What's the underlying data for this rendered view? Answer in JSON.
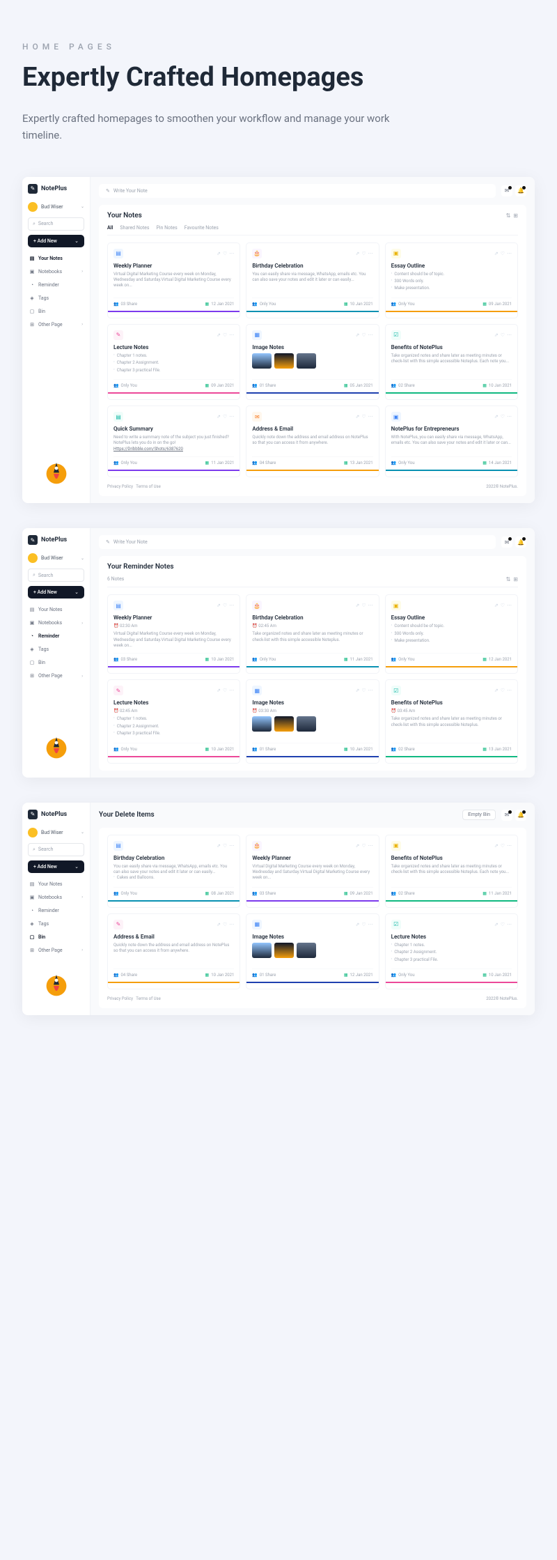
{
  "hero": {
    "eyebrow": "HOME PAGES",
    "headline": "Expertly Crafted Homepages",
    "subhead": "Expertly crafted homepages to smoothen your workflow and manage your work timeline."
  },
  "common": {
    "brand": "NotePlus",
    "user": "Bud Wiser",
    "search": "Search",
    "addnew": "Add New",
    "write": "Write Your Note",
    "nav": {
      "notes": "Your Notes",
      "notebooks": "Notebooks",
      "reminder": "Reminder",
      "tags": "Tags",
      "bin": "Bin",
      "other": "Other Page"
    },
    "footer": {
      "privacy": "Privacy Policy",
      "terms": "Terms of Use",
      "copy": "2022© NotePlus."
    }
  },
  "s1": {
    "title": "Your Notes",
    "tabs": {
      "all": "All",
      "shared": "Shared Notes",
      "pin": "Pin Notes",
      "fav": "Favourite Notes"
    },
    "cards": [
      {
        "title": "Weekly Planner",
        "body": "Virtual Digital Marketing Course every week on Monday, Wednesday and Saturday.Virtual Digital Marketing Course every week on...",
        "share": "03 Share",
        "date": "12 Jan 2021",
        "bar": "#7c3aed"
      },
      {
        "title": "Birthday Celebration",
        "body": "You can easily share via message, WhatsApp, emails etc. You can also save your notes and edit it later or can easily...",
        "share": "Only You",
        "date": "10 Jan 2021",
        "bar": "#0891b2"
      },
      {
        "title": "Essay Outline",
        "items": [
          "Content should be of topic.",
          "300 Words only.",
          "Make presentation."
        ],
        "share": "Only You",
        "date": "09 Jan 2021",
        "bar": "#f59e0b"
      },
      {
        "title": "Lecture Notes",
        "items": [
          "Chapter 1 notes.",
          "Chapter 2 Assignment.",
          "Chapter 3 practical File."
        ],
        "share": "Only You",
        "date": "09 Jan 2021",
        "bar": "#ec4899"
      },
      {
        "title": "Image Notes",
        "thumbs": true,
        "share": "01 Share",
        "date": "05 Jan 2021",
        "bar": "#1e40af"
      },
      {
        "title": "Benefits of NotePlus",
        "body": "Take organized notes and share later as meeting minutes or check-list with this simple accessible Noteplus. Each note you...",
        "share": "02 Share",
        "date": "10 Jan 2021",
        "bar": "#10b981"
      },
      {
        "title": "Quick Summary",
        "body": "Need to write a summary note of the subject you just finished? NotePlus lets you do in on the go!",
        "link": "Https://Dribbble.com/Shots/6387620",
        "share": "Only You",
        "date": "11 Jan 2021",
        "bar": "#7c3aed"
      },
      {
        "title": "Address & Email",
        "body": "Quickly note down the address and email address on NotePlus so that you can access it from anywhere.",
        "share": "04 Share",
        "date": "13 Jan 2021",
        "bar": "#f59e0b"
      },
      {
        "title": "NotePlus for Entrepreneurs",
        "body": "With NotePlus, you can easily share via message, WhatsApp, emails etc. You can also save your notes and edit it later or can...",
        "share": "Only You",
        "date": "14 Jan 2021",
        "bar": "#0891b2"
      }
    ]
  },
  "s2": {
    "title": "Your Reminder Notes",
    "count": "6 Notes",
    "cards": [
      {
        "title": "Weekly Planner",
        "time": "02:30 Am",
        "body": "Virtual Digital Marketing Course every week on Monday, Wednesday and Saturday.Virtual Digital Marketing Course every week on...",
        "share": "03 Share",
        "date": "10 Jan 2021",
        "bar": "#7c3aed"
      },
      {
        "title": "Birthday Celebration",
        "time": "02:45 Am",
        "body": "Take organized notes and share later as meeting minutes or check-list with this simple accessible Noteplus.",
        "share": "Only You",
        "date": "11 Jan 2021",
        "bar": "#0891b2"
      },
      {
        "title": "Essay Outline",
        "items": [
          "Content should be of topic.",
          "300 Words only.",
          "Make presentation."
        ],
        "share": "Only You",
        "date": "12 Jan 2021",
        "bar": "#f59e0b"
      },
      {
        "title": "Lecture Notes",
        "time": "02:45 Am",
        "items": [
          "Chapter 1 notes.",
          "Chapter 2 Assignment.",
          "Chapter 3 practical File."
        ],
        "share": "Only You",
        "date": "10 Jan 2021",
        "bar": "#ec4899"
      },
      {
        "title": "Image Notes",
        "time": "03:30 Am",
        "thumbs": true,
        "share": "01 Share",
        "date": "10 Jan 2021",
        "bar": "#1e40af"
      },
      {
        "title": "Benefits of NotePlus",
        "time": "03:45 Am",
        "body": "Take organized notes and share later as meeting minutes or check-list with this simple accessible Noteplus.",
        "share": "02 Share",
        "date": "13 Jan 2021",
        "bar": "#10b981"
      }
    ]
  },
  "s3": {
    "title": "Your Delete Items",
    "empty": "Empty Bin",
    "cards": [
      {
        "title": "Birthday Celebration",
        "body": "You can easily share via message, WhatsApp, emails etc. You can also save your notes and edit it later or can easily...",
        "extra": "Cakes and Balloons.",
        "share": "Only You",
        "date": "08 Jan 2021",
        "bar": "#0891b2"
      },
      {
        "title": "Weekly Planner",
        "body": "Virtual Digital Marketing Course every week on Monday, Wednesday and Saturday.Virtual Digital Marketing Course every week on...",
        "share": "03 Share",
        "date": "09 Jan 2021",
        "bar": "#7c3aed"
      },
      {
        "title": "Benefits of NotePlus",
        "body": "Take organized notes and share later as meeting minutes or check-list with this simple accessible Noteplus. Each note you...",
        "share": "02 Share",
        "date": "11 Jan 2021",
        "bar": "#10b981"
      },
      {
        "title": "Address & Email",
        "body": "Quickly note down the address and email address on NotePlus so that you can access it from anywhere.",
        "share": "04 Share",
        "date": "10 Jan 2021",
        "bar": "#f59e0b"
      },
      {
        "title": "Image Notes",
        "thumbs": true,
        "share": "01 Share",
        "date": "12 Jan 2021",
        "bar": "#1e40af"
      },
      {
        "title": "Lecture Notes",
        "items": [
          "Chapter 1 notes.",
          "Chapter 2 Assignment.",
          "Chapter 3 practical File."
        ],
        "share": "Only You",
        "date": "10 Jan 2021",
        "bar": "#ec4899"
      }
    ]
  }
}
